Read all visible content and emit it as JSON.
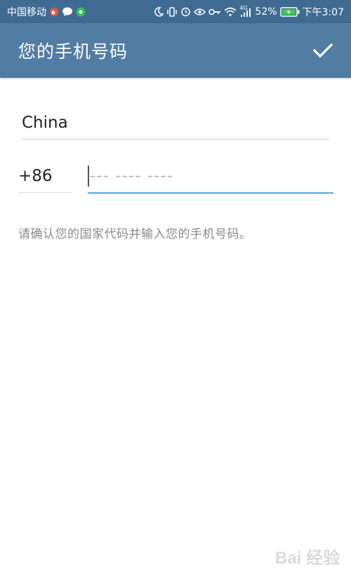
{
  "status_bar": {
    "carrier": "中国移动",
    "battery": "52%",
    "network": "4G",
    "time": "下午3:07",
    "icons": [
      "weibo-icon",
      "chat-icon",
      "wechat-icon",
      "moon-icon",
      "vibrate-icon",
      "alarm-icon",
      "eye-icon",
      "key-icon",
      "wifi-icon",
      "signal-icon",
      "battery-icon"
    ]
  },
  "toolbar": {
    "title": "您的手机号码",
    "done_icon": "check-icon"
  },
  "form": {
    "country": "China",
    "code": "+86",
    "phone_placeholder": "--- ---- ----",
    "hint": "请确认您的国家代码并输入您的手机号码。"
  },
  "watermark": "Bai 经验",
  "colors": {
    "statusbar": "#3f6b92",
    "toolbar": "#527da3",
    "accent": "#55a5e2"
  }
}
